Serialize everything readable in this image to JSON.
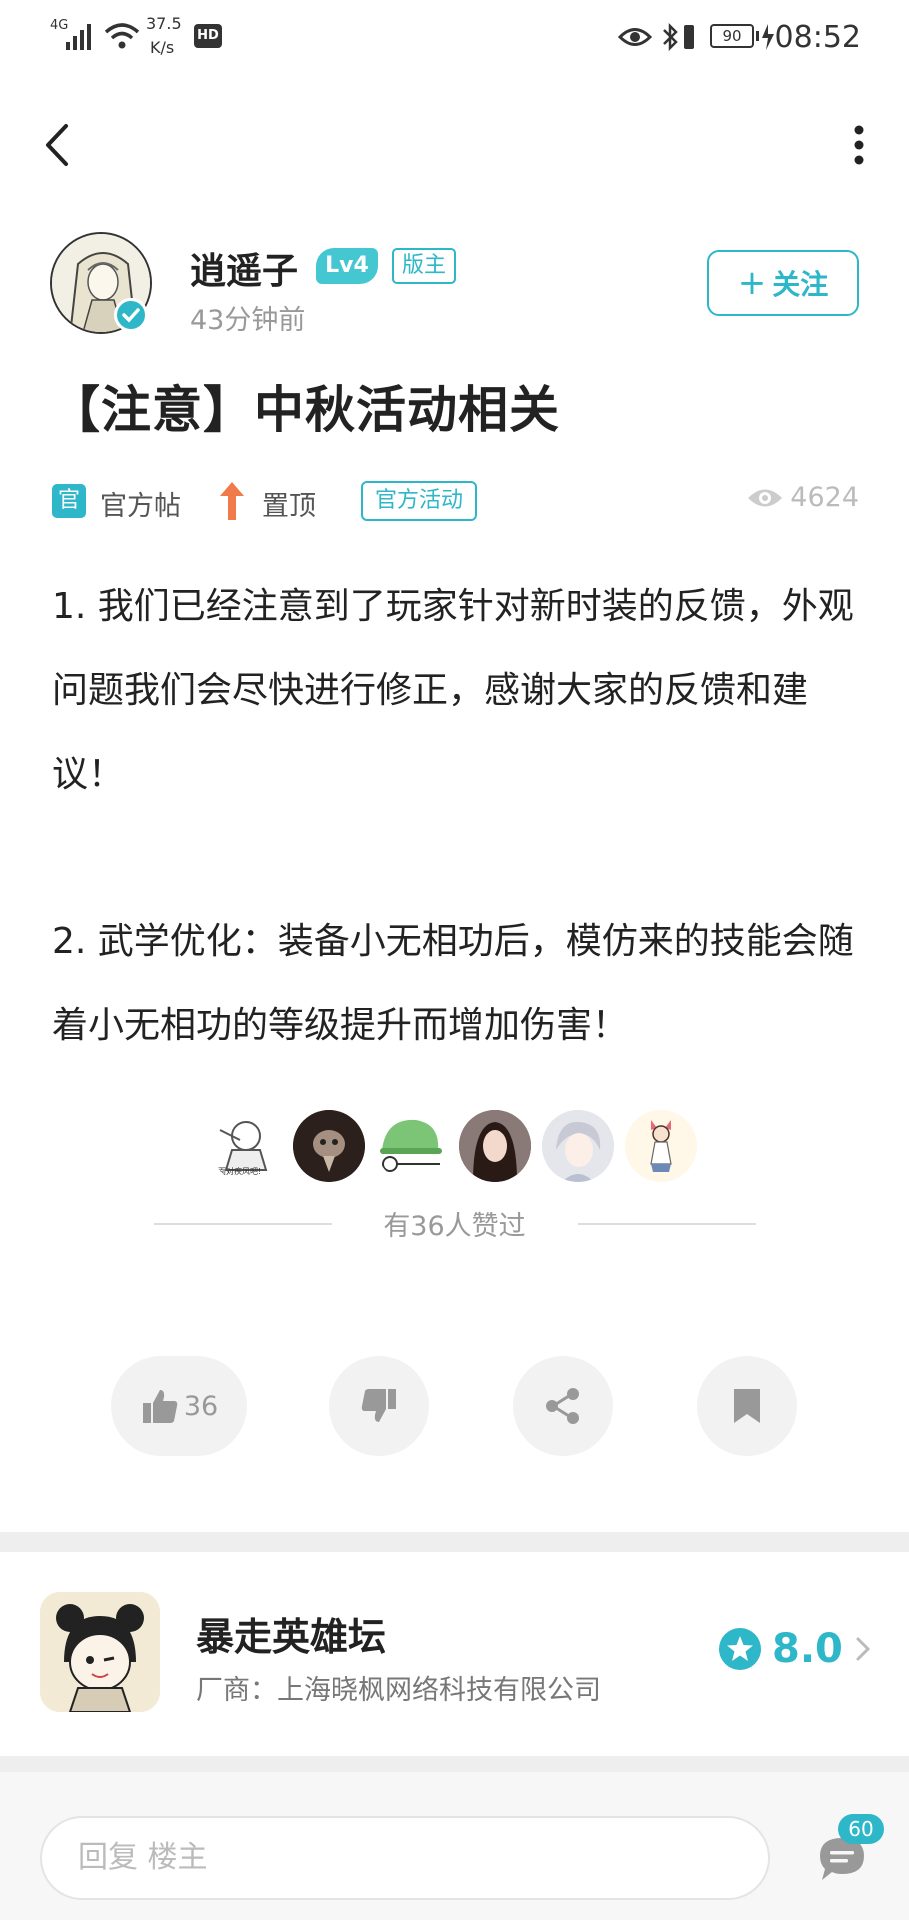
{
  "status_bar": {
    "network": "4G",
    "speed_value": "37.5",
    "speed_unit": "K/s",
    "hd": "HD",
    "battery": "90",
    "time": "08:52"
  },
  "author": {
    "name": "逍遥子",
    "level": "Lv4",
    "role": "版主",
    "time_ago": "43分钟前",
    "follow_label": "关注",
    "follow_prefix": "+"
  },
  "post": {
    "title": "【注意】中秋活动相关",
    "official_icon_text": "官",
    "official_label": "官方帖",
    "pinned_label": "置顶",
    "activity_tag": "官方活动",
    "views": "4624",
    "paragraphs": [
      "1. 我们已经注意到了玩家针对新时装的反馈，外观问题我们会尽快进行修正，感谢大家的反馈和建议！",
      "2. 武学优化：装备小无相功后，模仿来的技能会随着小无相功的等级提升而增加伤害！"
    ]
  },
  "likes": {
    "summary": "有36人赞过",
    "liker_avatar_text": "面对疾风吧!"
  },
  "actions": {
    "like_count": "36"
  },
  "game": {
    "name": "暴走英雄坛",
    "vendor": "厂商：上海晓枫网络科技有限公司",
    "score": "8.0"
  },
  "reply": {
    "placeholder": "回复  楼主",
    "comment_count": "60"
  },
  "colors": {
    "accent": "#2db7c9",
    "pin_arrow": "#f07a4a"
  }
}
